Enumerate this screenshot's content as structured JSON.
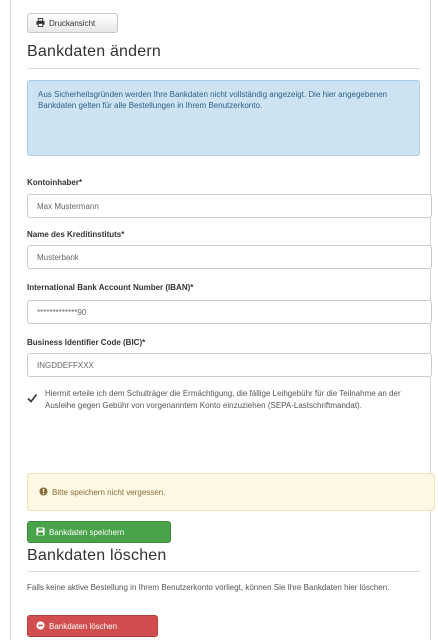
{
  "toolbar": {
    "print_label": "Druckansicht"
  },
  "section_change": {
    "title": "Bankdaten ändern",
    "info_text": "Aus Sicherheitsgründen werden Ihre Bankdaten nicht vollständig angezeigt. Die hier angegebenen Bankdaten gelten für alle Bestellungen in Ihrem Benutzerkonto."
  },
  "form": {
    "account_holder": {
      "label": "Kontoinhaber*",
      "value": "Max Mustermann"
    },
    "bank_name": {
      "label": "Name des Kreditinstituts*",
      "value": "Musterbank"
    },
    "iban": {
      "label": "International Bank Account Number (IBAN)*",
      "value": "*************90"
    },
    "bic": {
      "label": "Business Identifier Code (BIC)*",
      "value": "INGDDEFFXXX"
    },
    "mandate_checked": true,
    "mandate_text": "Hiermit erteile ich dem Schulträger die Ermächtigung, die fällige Leihgebühr für die Teilnahme an der Ausleihe gegen Gebühr von vorgenanntem Konto einzuziehen (SEPA-Lastschriftmandat).",
    "warning_text": "Bitte speichern nicht vergessen.",
    "save_label": "Bankdaten speichern"
  },
  "section_delete": {
    "title": "Bankdaten löschen",
    "text": "Falls keine aktive Bestellung in Ihrem Benutzerkonto vorliegt, können Sie Ihre Bankdaten hier löschen.",
    "delete_label": "Bankdaten löschen"
  },
  "icons": {
    "print": "printer-icon",
    "check": "checkmark-icon",
    "warning": "exclamation-circle-icon",
    "save": "floppy-disk-icon",
    "delete": "minus-circle-icon"
  },
  "colors": {
    "info_bg": "#cde3f2",
    "warning_bg": "#fcf8e3",
    "save_button": "#49a34a",
    "delete_button": "#d24e4e"
  }
}
